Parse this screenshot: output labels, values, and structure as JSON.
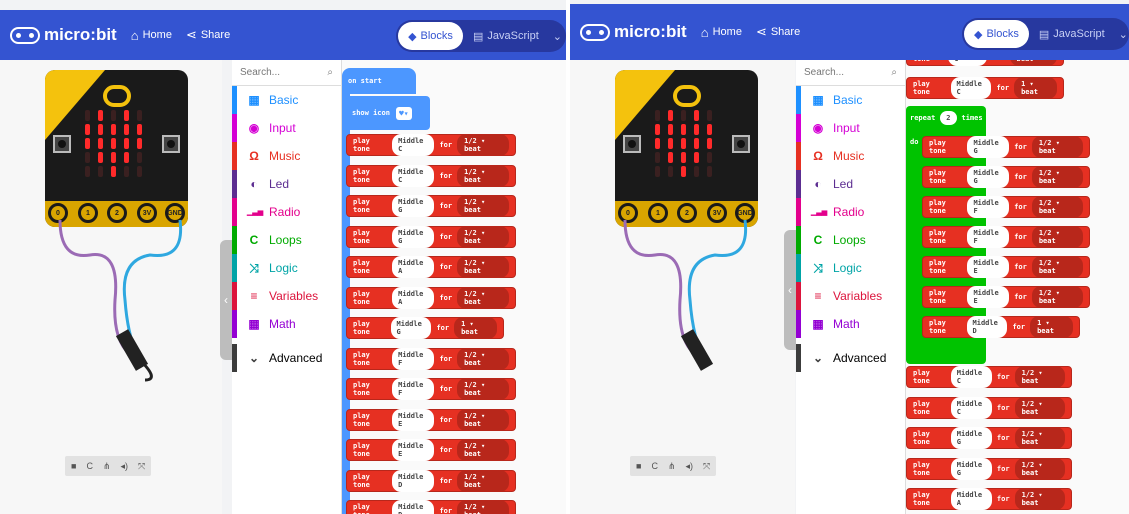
{
  "app": {
    "logo": "micro:bit",
    "home": "Home",
    "share": "Share",
    "blocks": "Blocks",
    "javascript": "JavaScript"
  },
  "toolbox": {
    "search_placeholder": "Search...",
    "categories": [
      {
        "label": "Basic",
        "icon": "grid-icon",
        "color": "#1e90ff"
      },
      {
        "label": "Input",
        "icon": "target-icon",
        "color": "#d400d4"
      },
      {
        "label": "Music",
        "icon": "headphones-icon",
        "color": "#e63022"
      },
      {
        "label": "Led",
        "icon": "toggle-icon",
        "color": "#5c2d91"
      },
      {
        "label": "Radio",
        "icon": "signal-icon",
        "color": "#e3008c"
      },
      {
        "label": "Loops",
        "icon": "loop-icon",
        "color": "#00aa00"
      },
      {
        "label": "Logic",
        "icon": "shuffle-icon",
        "color": "#00a4a6"
      },
      {
        "label": "Variables",
        "icon": "list-icon",
        "color": "#dc143c"
      },
      {
        "label": "Math",
        "icon": "calculator-icon",
        "color": "#9400d3"
      },
      {
        "label": "Advanced",
        "icon": "chevron-down-icon",
        "color": "#3c3c3c"
      }
    ]
  },
  "board": {
    "pins": [
      "0",
      "1",
      "2",
      "3V",
      "GND"
    ],
    "sound": "~12K"
  },
  "left_ws": {
    "on_start": "on start",
    "show_icon": "show icon",
    "play": "play tone",
    "for": "for",
    "notes": [
      [
        "Middle C",
        "1/2 ▾ beat"
      ],
      [
        "Middle C",
        "1/2 ▾ beat"
      ],
      [
        "Middle G",
        "1/2 ▾ beat"
      ],
      [
        "Middle G",
        "1/2 ▾ beat"
      ],
      [
        "Middle A",
        "1/2 ▾ beat"
      ],
      [
        "Middle A",
        "1/2 ▾ beat"
      ],
      [
        "Middle G",
        "1 ▾ beat"
      ],
      [
        "Middle F",
        "1/2 ▾ beat"
      ],
      [
        "Middle F",
        "1/2 ▾ beat"
      ],
      [
        "Middle E",
        "1/2 ▾ beat"
      ],
      [
        "Middle E",
        "1/2 ▾ beat"
      ],
      [
        "Middle D",
        "1/2 ▾ beat"
      ],
      [
        "Middle D",
        "1/2 ▾ beat"
      ]
    ]
  },
  "right_ws": {
    "top_partial": [
      "Middle G",
      "1/2 ▾ beat"
    ],
    "top": [
      "Middle C",
      "1 ▾ beat"
    ],
    "repeat": "repeat",
    "repeat_count": "2",
    "times": "times",
    "do": "do",
    "inner": [
      [
        "Middle G",
        "1/2 ▾ beat"
      ],
      [
        "Middle G",
        "1/2 ▾ beat"
      ],
      [
        "Middle F",
        "1/2 ▾ beat"
      ],
      [
        "Middle F",
        "1/2 ▾ beat"
      ],
      [
        "Middle E",
        "1/2 ▾ beat"
      ],
      [
        "Middle E",
        "1/2 ▾ beat"
      ],
      [
        "Middle D",
        "1 ▾ beat"
      ]
    ],
    "after": [
      [
        "Middle C",
        "1/2 ▾ beat"
      ],
      [
        "Middle C",
        "1/2 ▾ beat"
      ],
      [
        "Middle G",
        "1/2 ▾ beat"
      ],
      [
        "Middle G",
        "1/2 ▾ beat"
      ],
      [
        "Middle A",
        "1/2 ▾ beat"
      ]
    ]
  },
  "controls": [
    "■",
    "C",
    "⋔",
    "◂)",
    "⤧"
  ]
}
